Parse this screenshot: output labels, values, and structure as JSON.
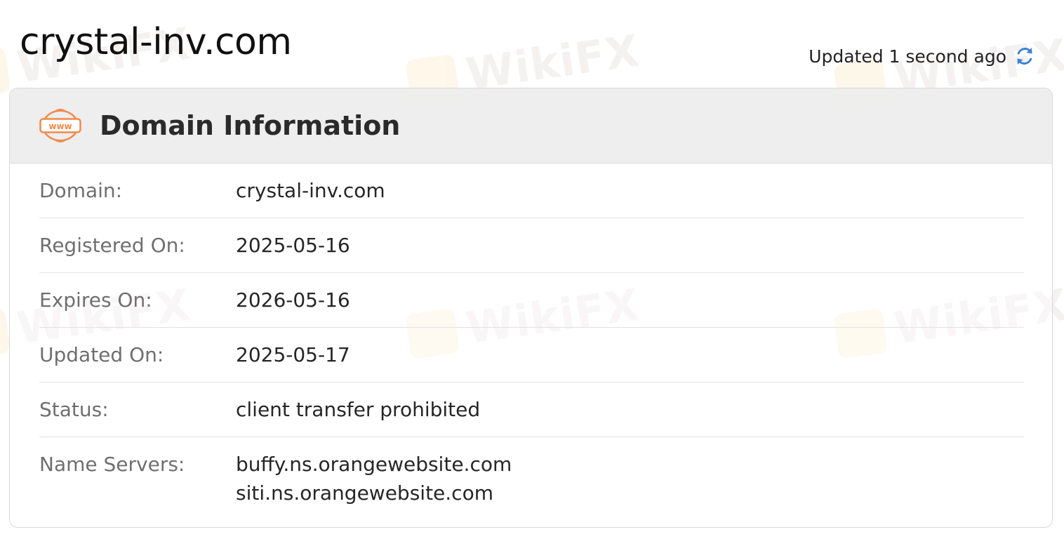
{
  "page": {
    "title": "crystal-inv.com",
    "updated_text": "Updated 1 second ago",
    "refresh_icon": "refresh-icon"
  },
  "watermark": {
    "text": "WikiFX",
    "icon": "eagle-logo-icon"
  },
  "card": {
    "icon": "www-icon",
    "title": "Domain Information",
    "rows": [
      {
        "label": "Domain:",
        "value": "crystal-inv.com"
      },
      {
        "label": "Registered On:",
        "value": "2025-05-16"
      },
      {
        "label": "Expires On:",
        "value": "2026-05-16"
      },
      {
        "label": "Updated On:",
        "value": "2025-05-17"
      },
      {
        "label": "Status:",
        "value": "client transfer prohibited"
      }
    ],
    "name_servers": {
      "label": "Name Servers:",
      "values": [
        "buffy.ns.orangewebsite.com",
        "siti.ns.orangewebsite.com"
      ]
    }
  },
  "colors": {
    "accent_orange": "#f08a4b",
    "refresh_blue": "#3b82d6",
    "header_bg": "#ebebeb"
  }
}
